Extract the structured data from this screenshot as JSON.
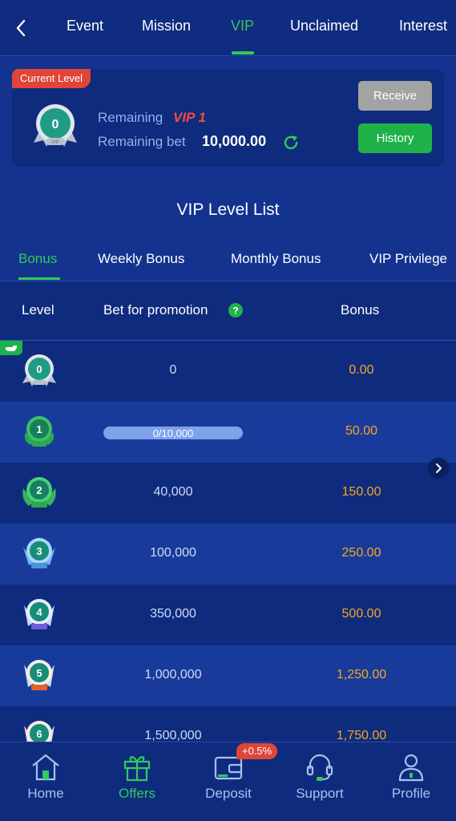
{
  "top_tabs": {
    "items": [
      {
        "label": "Event",
        "active": false
      },
      {
        "label": "Mission",
        "active": false
      },
      {
        "label": "VIP",
        "active": true
      },
      {
        "label": "Unclaimed",
        "active": false
      },
      {
        "label": "Interest",
        "active": false
      }
    ],
    "back_icon": "chevron-left-icon"
  },
  "current_level": {
    "badge": "Current Level",
    "medal_level": "0",
    "medal_text": "VIP",
    "remaining_label": "Remaining",
    "remaining_vip": "VIP 1",
    "remaining_bet_label": "Remaining bet",
    "remaining_bet_value": "10,000.00",
    "refresh_icon": "refresh-icon",
    "receive_label": "Receive",
    "history_label": "History"
  },
  "level_list": {
    "title": "VIP Level List",
    "sub_tabs": [
      {
        "label": "Bonus",
        "active": true
      },
      {
        "label": "Weekly Bonus",
        "active": false
      },
      {
        "label": "Monthly Bonus",
        "active": false
      },
      {
        "label": "VIP Privilege",
        "active": false
      }
    ],
    "headers": {
      "level": "Level",
      "bet": "Bet for promotion",
      "bonus": "Bonus"
    },
    "rows": [
      {
        "level": "0",
        "bet": "0",
        "bonus": "0.00",
        "current": true
      },
      {
        "level": "1",
        "bet": "0/10,000",
        "bonus": "50.00",
        "progress": 0
      },
      {
        "level": "2",
        "bet": "40,000",
        "bonus": "150.00"
      },
      {
        "level": "3",
        "bet": "100,000",
        "bonus": "250.00"
      },
      {
        "level": "4",
        "bet": "350,000",
        "bonus": "500.00"
      },
      {
        "level": "5",
        "bet": "1,000,000",
        "bonus": "1,250.00"
      },
      {
        "level": "6",
        "bet": "1,500,000",
        "bonus": "1,750.00"
      }
    ]
  },
  "bottom_nav": {
    "items": [
      {
        "label": "Home",
        "icon": "home-icon",
        "active": false
      },
      {
        "label": "Offers",
        "icon": "gift-icon",
        "active": true
      },
      {
        "label": "Deposit",
        "icon": "wallet-icon",
        "active": false
      },
      {
        "label": "Support",
        "icon": "headset-icon",
        "active": false
      },
      {
        "label": "Profile",
        "icon": "person-icon",
        "active": false
      }
    ],
    "deposit_badge": "+0.5%"
  },
  "colors": {
    "background": "#13338f",
    "accent_green": "#2ecc5a",
    "bonus_orange": "#f5a623",
    "badge_red": "#e0453a"
  }
}
